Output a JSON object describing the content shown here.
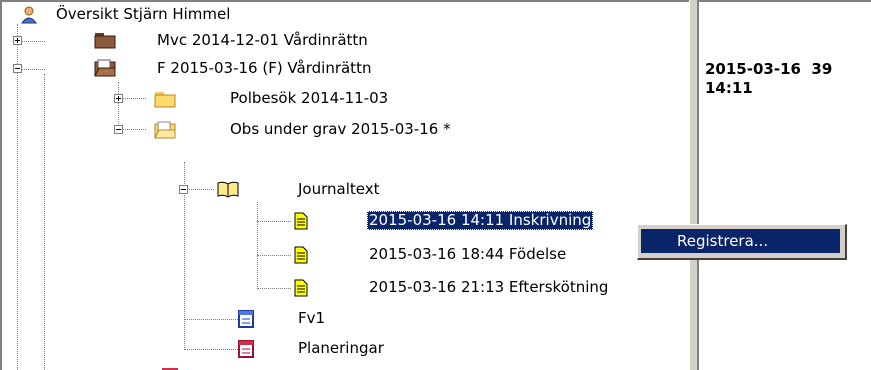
{
  "tree": {
    "root": "Översikt Stjärn Himmel",
    "nodes": {
      "mvc": "Mvc 2014-12-01  Vårdinrättn",
      "f2015": "F 2015-03-16 (F)  Vårdinrättn",
      "polbesok": "Polbesök 2014-11-03",
      "obs": "Obs under grav 2015-03-16 *",
      "journaltext": "Journaltext",
      "entry1": "2015-03-16 14:11 Inskrivning",
      "entry2": "2015-03-16 18:44 Födelse",
      "entry3": "2015-03-16 21:13 Efterskötning",
      "fv1": "Fv1",
      "planeringar": "Planeringar"
    }
  },
  "context_menu": {
    "registrera": "Registrera..."
  },
  "right_panel": {
    "line1": "2015-03-16  39",
    "line2": "14:11"
  },
  "colors": {
    "selection": "#0a246a",
    "folder_brown": "#8b5a3c",
    "folder_yellow": "#ffd86b",
    "doc_yellow": "#ffff00"
  }
}
